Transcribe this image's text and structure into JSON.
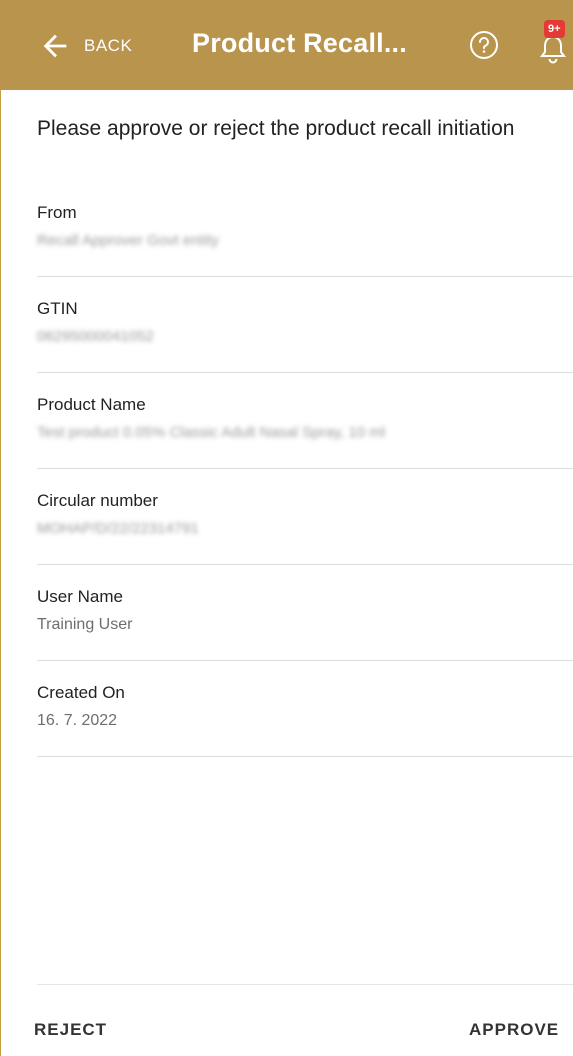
{
  "header": {
    "back_label": "BACK",
    "title": "Product Recall...",
    "notification_badge": "9+",
    "background_color": "#b8944d"
  },
  "instruction": "Please approve or reject the product recall initiation",
  "fields": [
    {
      "label": "From",
      "value": "Recall Approver Govt entity"
    },
    {
      "label": "GTIN",
      "value": "06295000041052"
    },
    {
      "label": "Product Name",
      "value": "Test product 0.05% Classic Adult Nasal Spray, 10 ml"
    },
    {
      "label": "Circular number",
      "value": "MOHAP/D/22/22314791"
    },
    {
      "label": "User Name",
      "value": "Training User"
    },
    {
      "label": "Created On",
      "value": "16. 7. 2022"
    }
  ],
  "actions": {
    "reject_label": "REJECT",
    "approve_label": "APPROVE"
  }
}
